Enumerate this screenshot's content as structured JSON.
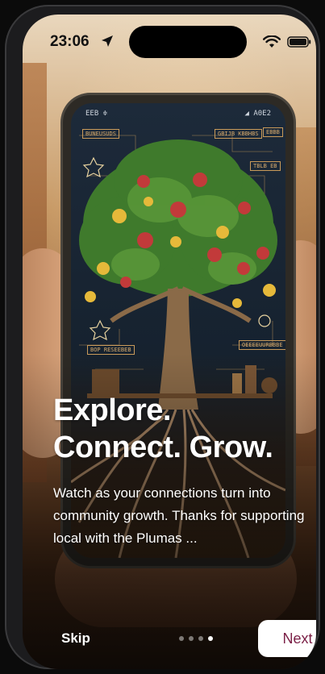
{
  "status_bar": {
    "time": "23:06",
    "icons": [
      "location-arrow-icon",
      "wifi-icon",
      "battery-icon"
    ]
  },
  "hero_image": {
    "labels": {
      "inner_status_left": "EEB ≑",
      "inner_status_right": "◢ A0E2",
      "box_top_left": "BUNEUSUDS",
      "box_top_mid": "GBIJB KBBHBS",
      "box_top_right": "EBBB",
      "box_right_2": "TBLB EB",
      "box_bottom_left": "BOP RESEEBEB",
      "box_bottom_right": "OEEEEUURBBBE"
    }
  },
  "onboarding": {
    "headline_line1": "Explore.",
    "headline_line2": "Connect. Grow.",
    "body": "Watch as your connections turn into community growth. Thanks for supporting local with the Plumas ...",
    "page_count": 4,
    "active_page": 4
  },
  "actions": {
    "skip_label": "Skip",
    "next_label": "Next"
  },
  "colors": {
    "next_text": "#7a1f46",
    "overlay_text": "#ffffff"
  }
}
